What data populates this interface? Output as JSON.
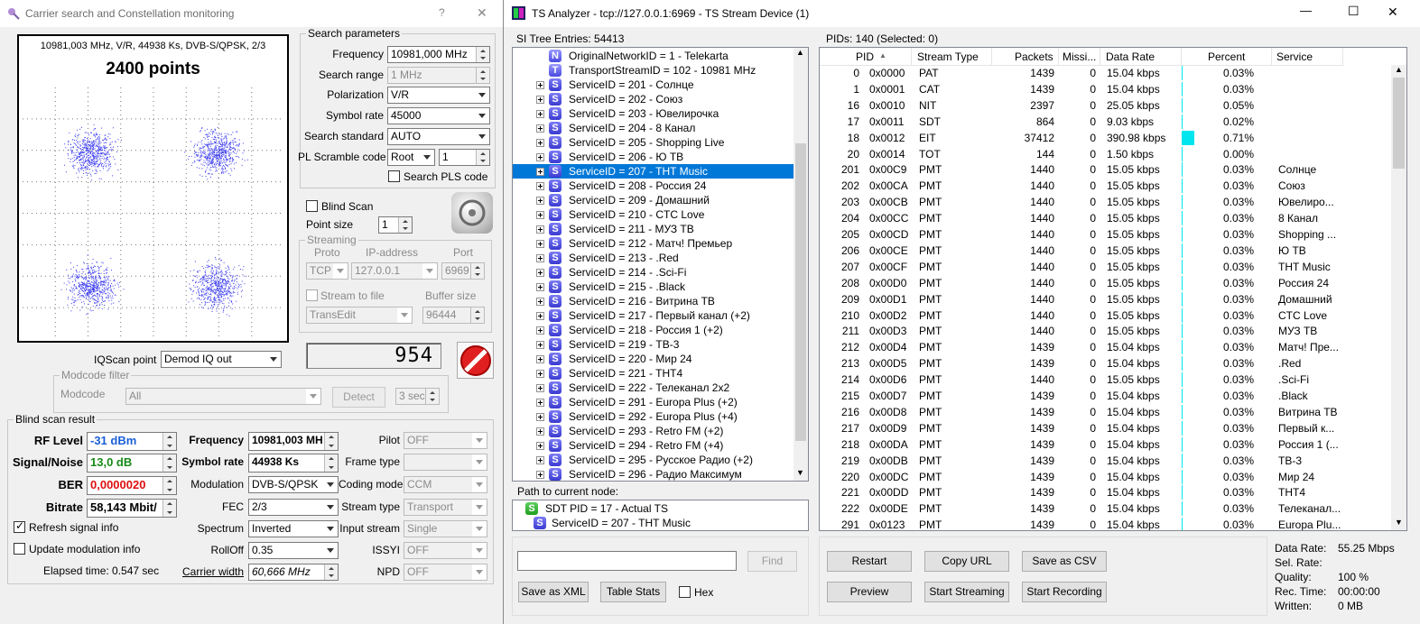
{
  "left_window": {
    "title": "Carrier search and Constellation monitoring",
    "help_label": "?",
    "close_label": "✕",
    "constellation": {
      "info": "10981,003 MHz, V/R, 44938 Ks, DVB-S/QPSK, 2/3",
      "points": "2400 points"
    },
    "search_params": {
      "title": "Search parameters",
      "frequency_label": "Frequency",
      "frequency_value": "10981,000 MHz",
      "search_range_label": "Search range",
      "search_range_value": "1 MHz",
      "polarization_label": "Polarization",
      "polarization_value": "V/R",
      "symbol_rate_label": "Symbol rate",
      "symbol_rate_value": "45000",
      "search_standard_label": "Search standard",
      "search_standard_value": "AUTO",
      "pl_scramble_label": "PL Scramble code",
      "pl_scramble_mode": "Root",
      "pl_scramble_value": "1",
      "search_pls_label": "Search PLS code"
    },
    "blind_scan_label": "Blind Scan",
    "point_size_label": "Point size",
    "point_size_value": "1",
    "streaming": {
      "title": "Streaming",
      "proto_label": "Proto",
      "ip_label": "IP-address",
      "port_label": "Port",
      "proto_value": "TCP",
      "ip_value": "127.0.0.1",
      "port_value": "6969",
      "stream_to_file_label": "Stream to file",
      "buffer_size_label": "Buffer size",
      "transedit_value": "TransEdit",
      "buffer_value": "96444"
    },
    "counter": "954",
    "iqscan_label": "IQScan point",
    "iqscan_value": "Demod IQ out",
    "modcode": {
      "title": "Modcode filter",
      "label": "Modcode",
      "value": "All",
      "detect_label": "Detect",
      "sec_value": "3 sec"
    },
    "blind_result": {
      "title": "Blind scan result",
      "rf_label": "RF Level",
      "rf_value": "-31 dBm",
      "sn_label": "Signal/Noise",
      "sn_value": "13,0 dB",
      "ber_label": "BER",
      "ber_value": "0,0000020",
      "bitrate_label": "Bitrate",
      "bitrate_value": "58,143 Mbit/",
      "freq_label": "Frequency",
      "freq_value": "10981,003 MH",
      "symrate_label": "Symbol rate",
      "symrate_value": "44938 Ks",
      "modulation_label": "Modulation",
      "modulation_value": "DVB-S/QPSK",
      "fec_label": "FEC",
      "fec_value": "2/3",
      "spectrum_label": "Spectrum",
      "spectrum_value": "Inverted",
      "rolloff_label": "RollOff",
      "rolloff_value": "0.35",
      "carrier_width_label": "Carrier width",
      "carrier_width_value": "60,666 MHz",
      "pilot_label": "Pilot",
      "pilot_value": "OFF",
      "frame_type_label": "Frame type",
      "frame_type_value": "",
      "coding_mode_label": "Coding mode",
      "coding_mode_value": "CCM",
      "stream_type_label": "Stream type",
      "stream_type_value": "Transport",
      "input_stream_label": "Input stream",
      "input_stream_value": "Single",
      "issyi_label": "ISSYI",
      "issyi_value": "OFF",
      "npd_label": "NPD",
      "npd_value": "OFF",
      "refresh_label": "Refresh signal info",
      "update_mod_label": "Update modulation info",
      "elapsed": "Elapsed time: 0.547 sec"
    },
    "colors": {
      "rf": "#1a5fd6",
      "sn": "#168a16",
      "ber": "#e01010",
      "dots": "#3a3af0"
    }
  },
  "right_window": {
    "title": "TS Analyzer - tcp://127.0.0.1:6969 - TS Stream Device (1)",
    "minimize": "—",
    "maximize": "☐",
    "close": "✕",
    "si_tree_label": "SI Tree Entries: 54413",
    "pids_label": "PIDs: 140   (Selected: 0)",
    "tree": [
      {
        "icon": "N",
        "text": "OriginalNetworkID = 1 - Telekarta",
        "expand": false
      },
      {
        "icon": "T",
        "text": "TransportStreamID = 102 - 10981 MHz",
        "expand": false
      },
      {
        "icon": "S",
        "text": "ServiceID = 201 - Солнце",
        "expand": true
      },
      {
        "icon": "S",
        "text": "ServiceID = 202 - Союз",
        "expand": true
      },
      {
        "icon": "S",
        "text": "ServiceID = 203 - Ювелирочка",
        "expand": true
      },
      {
        "icon": "S",
        "text": "ServiceID = 204 - 8 Канал",
        "expand": true
      },
      {
        "icon": "S",
        "text": "ServiceID = 205 - Shopping Live",
        "expand": true
      },
      {
        "icon": "S",
        "text": "ServiceID = 206 - Ю ТВ",
        "expand": true
      },
      {
        "icon": "S",
        "text": "ServiceID = 207 - THT Music",
        "expand": true,
        "selected": true
      },
      {
        "icon": "S",
        "text": "ServiceID = 208 - Россия 24",
        "expand": true
      },
      {
        "icon": "S",
        "text": "ServiceID = 209 - Домашний",
        "expand": true
      },
      {
        "icon": "S",
        "text": "ServiceID = 210 - CTC Love",
        "expand": true
      },
      {
        "icon": "S",
        "text": "ServiceID = 211 - МУЗ ТВ",
        "expand": true
      },
      {
        "icon": "S",
        "text": "ServiceID = 212 - Матч! Премьер",
        "expand": true
      },
      {
        "icon": "S",
        "text": "ServiceID = 213 - .Red",
        "expand": true
      },
      {
        "icon": "S",
        "text": "ServiceID = 214 - .Sci-Fi",
        "expand": true
      },
      {
        "icon": "S",
        "text": "ServiceID = 215 - .Black",
        "expand": true
      },
      {
        "icon": "S",
        "text": "ServiceID = 216 - Витрина ТВ",
        "expand": true
      },
      {
        "icon": "S",
        "text": "ServiceID = 217 - Первый канал (+2)",
        "expand": true
      },
      {
        "icon": "S",
        "text": "ServiceID = 218 - Россия 1 (+2)",
        "expand": true
      },
      {
        "icon": "S",
        "text": "ServiceID = 219 - ТВ-3",
        "expand": true
      },
      {
        "icon": "S",
        "text": "ServiceID = 220 - Мир 24",
        "expand": true
      },
      {
        "icon": "S",
        "text": "ServiceID = 221 - THT4",
        "expand": true
      },
      {
        "icon": "S",
        "text": "ServiceID = 222 - Телеканал 2x2",
        "expand": true
      },
      {
        "icon": "S",
        "text": "ServiceID = 291 - Europa Plus (+2)",
        "expand": true
      },
      {
        "icon": "S",
        "text": "ServiceID = 292 - Europa Plus (+4)",
        "expand": true
      },
      {
        "icon": "S",
        "text": "ServiceID = 293 - Retro FM (+2)",
        "expand": true
      },
      {
        "icon": "S",
        "text": "ServiceID = 294 - Retro FM (+4)",
        "expand": true
      },
      {
        "icon": "S",
        "text": "ServiceID = 295 - Русское Радио (+2)",
        "expand": true
      },
      {
        "icon": "S",
        "text": "ServiceID = 296 - Радио Максимум",
        "expand": true
      }
    ],
    "path_label": "Path to current node:",
    "path": [
      "SDT PID = 17 - Actual TS",
      "ServiceID = 207 - THT Music"
    ],
    "columns": [
      "PID",
      "Stream Type",
      "Packets",
      "Missi...",
      "Data Rate",
      "Percent",
      "Service"
    ],
    "rows": [
      [
        "0",
        "0x0000",
        "PAT",
        "1439",
        "0",
        "15.04 kbps",
        "0.03%",
        ""
      ],
      [
        "1",
        "0x0001",
        "CAT",
        "1439",
        "0",
        "15.04 kbps",
        "0.03%",
        ""
      ],
      [
        "16",
        "0x0010",
        "NIT",
        "2397",
        "0",
        "25.05 kbps",
        "0.05%",
        ""
      ],
      [
        "17",
        "0x0011",
        "SDT",
        "864",
        "0",
        "9.03 kbps",
        "0.02%",
        ""
      ],
      [
        "18",
        "0x0012",
        "EIT",
        "37412",
        "0",
        "390.98 kbps",
        "0.71%",
        ""
      ],
      [
        "20",
        "0x0014",
        "TOT",
        "144",
        "0",
        "1.50 kbps",
        "0.00%",
        ""
      ],
      [
        "201",
        "0x00C9",
        "PMT",
        "1440",
        "0",
        "15.05 kbps",
        "0.03%",
        "Солнце"
      ],
      [
        "202",
        "0x00CA",
        "PMT",
        "1440",
        "0",
        "15.05 kbps",
        "0.03%",
        "Союз"
      ],
      [
        "203",
        "0x00CB",
        "PMT",
        "1440",
        "0",
        "15.05 kbps",
        "0.03%",
        "Ювелиро..."
      ],
      [
        "204",
        "0x00CC",
        "PMT",
        "1440",
        "0",
        "15.05 kbps",
        "0.03%",
        "8 Канал"
      ],
      [
        "205",
        "0x00CD",
        "PMT",
        "1440",
        "0",
        "15.05 kbps",
        "0.03%",
        "Shopping ..."
      ],
      [
        "206",
        "0x00CE",
        "PMT",
        "1440",
        "0",
        "15.05 kbps",
        "0.03%",
        "Ю ТВ"
      ],
      [
        "207",
        "0x00CF",
        "PMT",
        "1440",
        "0",
        "15.05 kbps",
        "0.03%",
        "THT Music"
      ],
      [
        "208",
        "0x00D0",
        "PMT",
        "1440",
        "0",
        "15.05 kbps",
        "0.03%",
        "Россия 24"
      ],
      [
        "209",
        "0x00D1",
        "PMT",
        "1440",
        "0",
        "15.05 kbps",
        "0.03%",
        "Домашний"
      ],
      [
        "210",
        "0x00D2",
        "PMT",
        "1440",
        "0",
        "15.05 kbps",
        "0.03%",
        "CTC Love"
      ],
      [
        "211",
        "0x00D3",
        "PMT",
        "1440",
        "0",
        "15.05 kbps",
        "0.03%",
        "МУЗ ТВ"
      ],
      [
        "212",
        "0x00D4",
        "PMT",
        "1439",
        "0",
        "15.04 kbps",
        "0.03%",
        "Матч! Пре..."
      ],
      [
        "213",
        "0x00D5",
        "PMT",
        "1439",
        "0",
        "15.04 kbps",
        "0.03%",
        ".Red"
      ],
      [
        "214",
        "0x00D6",
        "PMT",
        "1440",
        "0",
        "15.05 kbps",
        "0.03%",
        ".Sci-Fi"
      ],
      [
        "215",
        "0x00D7",
        "PMT",
        "1439",
        "0",
        "15.04 kbps",
        "0.03%",
        ".Black"
      ],
      [
        "216",
        "0x00D8",
        "PMT",
        "1439",
        "0",
        "15.04 kbps",
        "0.03%",
        "Витрина ТВ"
      ],
      [
        "217",
        "0x00D9",
        "PMT",
        "1439",
        "0",
        "15.04 kbps",
        "0.03%",
        "Первый к..."
      ],
      [
        "218",
        "0x00DA",
        "PMT",
        "1439",
        "0",
        "15.04 kbps",
        "0.03%",
        "Россия 1 (..."
      ],
      [
        "219",
        "0x00DB",
        "PMT",
        "1439",
        "0",
        "15.04 kbps",
        "0.03%",
        "ТВ-3"
      ],
      [
        "220",
        "0x00DC",
        "PMT",
        "1439",
        "0",
        "15.04 kbps",
        "0.03%",
        "Мир 24"
      ],
      [
        "221",
        "0x00DD",
        "PMT",
        "1439",
        "0",
        "15.04 kbps",
        "0.03%",
        "THT4"
      ],
      [
        "222",
        "0x00DE",
        "PMT",
        "1439",
        "0",
        "15.04 kbps",
        "0.03%",
        "Телеканал..."
      ],
      [
        "291",
        "0x0123",
        "PMT",
        "1439",
        "0",
        "15.04 kbps",
        "0.03%",
        "Europa Plu..."
      ]
    ],
    "find_label": "Find",
    "save_xml_label": "Save as XML",
    "table_stats_label": "Table Stats",
    "hex_label": "Hex",
    "restart_label": "Restart",
    "copy_url_label": "Copy URL",
    "save_csv_label": "Save as CSV",
    "preview_label": "Preview",
    "start_streaming_label": "Start Streaming",
    "start_recording_label": "Start Recording",
    "stats": {
      "data_rate_label": "Data Rate:",
      "data_rate_value": "55.25 Mbps",
      "sel_rate_label": "Sel. Rate:",
      "sel_rate_value": "",
      "quality_label": "Quality:",
      "quality_value": "100 %",
      "rec_time_label": "Rec. Time:",
      "rec_time_value": "00:00:00",
      "written_label": "Written:",
      "written_value": "0 MB"
    },
    "colors": {
      "bar": "#00e5ee",
      "selection": "#0078d7"
    }
  }
}
